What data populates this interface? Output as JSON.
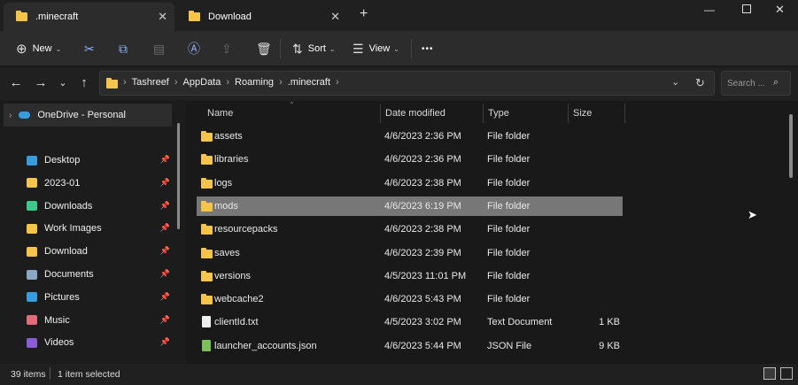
{
  "tabs": [
    {
      "label": ".minecraft"
    },
    {
      "label": "Download"
    }
  ],
  "toolbar": {
    "new": "New",
    "sort": "Sort",
    "view": "View",
    "more": "•••"
  },
  "breadcrumb": [
    "Tashreef",
    "AppData",
    "Roaming",
    ".minecraft"
  ],
  "search": {
    "placeholder": "Search ..."
  },
  "nav": {
    "top": "OneDrive - Personal",
    "items": [
      {
        "label": "Desktop",
        "icon": "desktop-icon",
        "color": "#3a9bdc"
      },
      {
        "label": "2023-01",
        "icon": "folder-icon",
        "color": "#f4c54a"
      },
      {
        "label": "Downloads",
        "icon": "download-icon",
        "color": "#3ac98a"
      },
      {
        "label": "Work Images",
        "icon": "folder-icon",
        "color": "#f4c54a"
      },
      {
        "label": "Download",
        "icon": "folder-icon",
        "color": "#f4c54a"
      },
      {
        "label": "Documents",
        "icon": "documents-icon",
        "color": "#8aa6c8"
      },
      {
        "label": "Pictures",
        "icon": "pictures-icon",
        "color": "#3a9bdc"
      },
      {
        "label": "Music",
        "icon": "music-icon",
        "color": "#e06b7a"
      },
      {
        "label": "Videos",
        "icon": "videos-icon",
        "color": "#8a5cd6"
      }
    ]
  },
  "columns": {
    "name": "Name",
    "date": "Date modified",
    "type": "Type",
    "size": "Size"
  },
  "files": [
    {
      "name": "assets",
      "date": "4/6/2023 2:36 PM",
      "type": "File folder",
      "size": "",
      "kind": "folder"
    },
    {
      "name": "libraries",
      "date": "4/6/2023 2:36 PM",
      "type": "File folder",
      "size": "",
      "kind": "folder"
    },
    {
      "name": "logs",
      "date": "4/6/2023 2:38 PM",
      "type": "File folder",
      "size": "",
      "kind": "folder"
    },
    {
      "name": "mods",
      "date": "4/6/2023 6:19 PM",
      "type": "File folder",
      "size": "",
      "kind": "folder"
    },
    {
      "name": "resourcepacks",
      "date": "4/6/2023 2:38 PM",
      "type": "File folder",
      "size": "",
      "kind": "folder"
    },
    {
      "name": "saves",
      "date": "4/6/2023 2:39 PM",
      "type": "File folder",
      "size": "",
      "kind": "folder"
    },
    {
      "name": "versions",
      "date": "4/5/2023 11:01 PM",
      "type": "File folder",
      "size": "",
      "kind": "folder"
    },
    {
      "name": "webcache2",
      "date": "4/6/2023 5:43 PM",
      "type": "File folder",
      "size": "",
      "kind": "folder"
    },
    {
      "name": "clientId.txt",
      "date": "4/5/2023 3:02 PM",
      "type": "Text Document",
      "size": "1 KB",
      "kind": "txt"
    },
    {
      "name": "launcher_accounts.json",
      "date": "4/6/2023 5:44 PM",
      "type": "JSON File",
      "size": "9 KB",
      "kind": "json"
    }
  ],
  "selected_index": 3,
  "status": {
    "count": "39 items",
    "selected": "1 item selected"
  }
}
